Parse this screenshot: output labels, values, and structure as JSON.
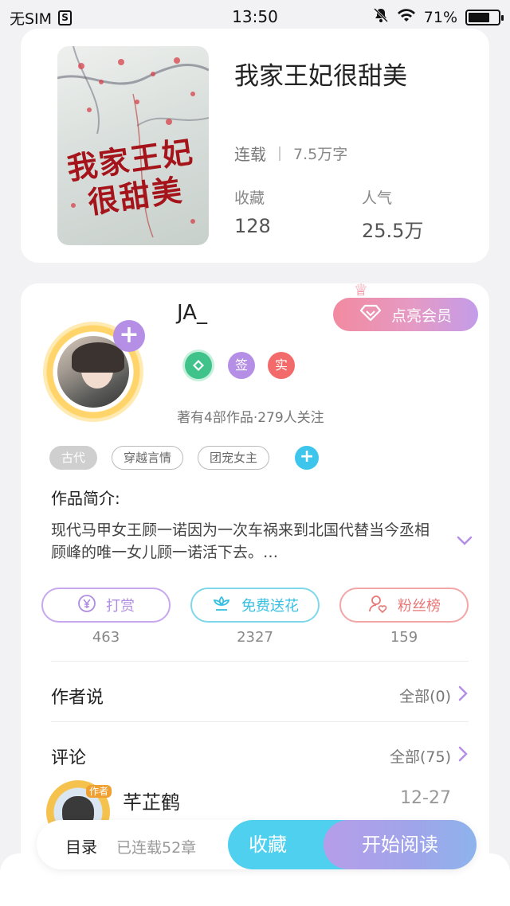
{
  "status_bar": {
    "carrier": "无SIM",
    "sim_icon": "S",
    "time": "13:50",
    "battery": "71%",
    "battery_level": 0.71
  },
  "book": {
    "cover_title_line1": "我家王妃",
    "cover_title_line2": "很甜美",
    "title": "我家王妃很甜美",
    "status": "连载",
    "word_count": "7.5万字",
    "favorites_label": "收藏",
    "favorites_value": "128",
    "popularity_label": "人气",
    "popularity_value": "25.5万"
  },
  "author": {
    "name": "JA_",
    "vip_label": "点亮会员",
    "badge_sign": "签",
    "badge_real": "实",
    "stats": "著有4部作品·279人关注",
    "add_icon": "+"
  },
  "tags": [
    "古代",
    "穿越言情",
    "团宠女主"
  ],
  "tag_add": "+",
  "intro": {
    "title": "作品简介:",
    "text": "现代马甲女王顾一诺因为一次车祸来到北国代替当今丞相顾峰的唯一女儿顾一诺活下去。…"
  },
  "actions": [
    {
      "label": "打赏",
      "count": "463",
      "icon": "yen-coin-icon"
    },
    {
      "label": "免费送花",
      "count": "2327",
      "icon": "flower-icon"
    },
    {
      "label": "粉丝榜",
      "count": "159",
      "icon": "fans-icon"
    }
  ],
  "author_says": {
    "title": "作者说",
    "link": "全部(0)"
  },
  "comments": {
    "title": "评论",
    "link": "全部(75)",
    "first": {
      "author_chip": "作者",
      "name": "芊芷鹤",
      "date": "12-27"
    }
  },
  "bottom_bar": {
    "toc": "目录",
    "serial": "已连载52章",
    "favorite": "收藏",
    "read": "开始阅读"
  },
  "colors": {
    "accent_purple": "#b58ee6",
    "accent_cyan": "#4fd0ef",
    "accent_red": "#e87777"
  }
}
